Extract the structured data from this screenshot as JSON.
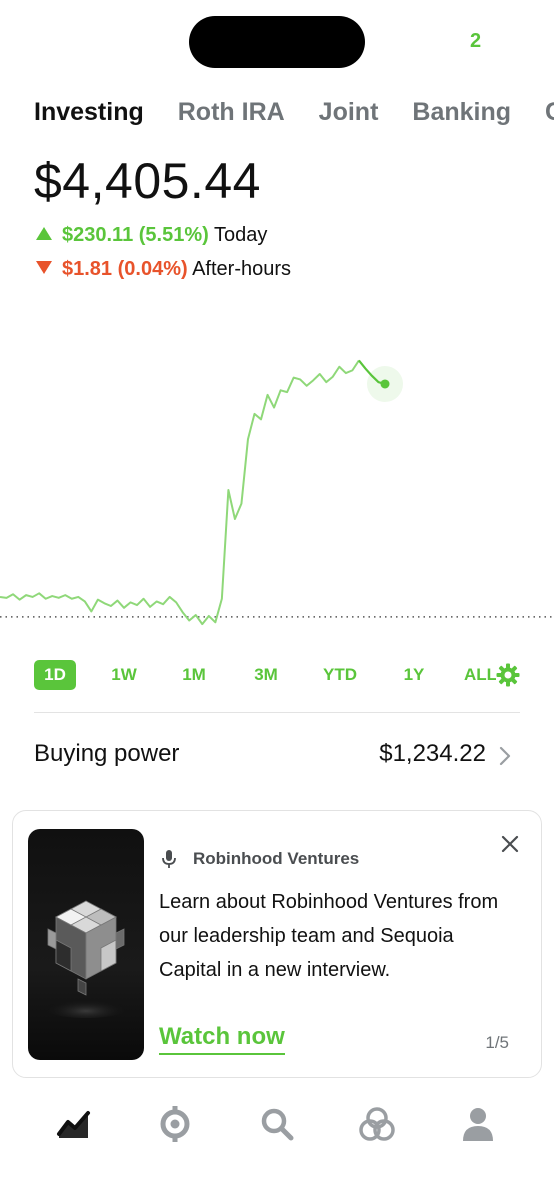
{
  "status_bar": {
    "badge": "2"
  },
  "tabs": [
    {
      "label": "Investing",
      "active": true
    },
    {
      "label": "Roth IRA",
      "active": false
    },
    {
      "label": "Joint",
      "active": false
    },
    {
      "label": "Banking",
      "active": false
    },
    {
      "label": "Cr",
      "active": false
    }
  ],
  "portfolio": {
    "balance": "$4,405.44",
    "today": {
      "value": "$230.11 (5.51%)",
      "label": "Today",
      "direction": "up"
    },
    "after_hours": {
      "value": "$1.81 (0.04%)",
      "label": "After-hours",
      "direction": "down"
    }
  },
  "chart_data": {
    "type": "line",
    "series": [
      {
        "values": [
          2.2,
          2.1,
          2.5,
          1.9,
          2.4,
          2.2,
          2.6,
          2.0,
          2.3,
          2.1,
          2.4,
          2.0,
          2.2,
          1.7,
          0.6,
          1.9,
          1.5,
          1.2,
          1.8,
          1.0,
          1.6,
          1.3,
          2.0,
          1.1,
          1.7,
          1.4,
          2.2,
          1.6,
          0.5,
          -0.4,
          0.2,
          -0.8,
          0.1,
          -0.6,
          2.0,
          14.0,
          10.8,
          12.5,
          19.6,
          22.4,
          21.8,
          24.5,
          23.1,
          25.0,
          24.8,
          26.4,
          26.2,
          25.5,
          26.1,
          26.8,
          25.9,
          26.5,
          27.6,
          26.9,
          27.2,
          28.3,
          27.4,
          26.6,
          25.9,
          25.7
        ]
      }
    ],
    "baseline": 0,
    "up_color": "#5ac53b"
  },
  "ranges": [
    {
      "label": "1D",
      "active": true
    },
    {
      "label": "1W",
      "active": false
    },
    {
      "label": "1M",
      "active": false
    },
    {
      "label": "3M",
      "active": false
    },
    {
      "label": "YTD",
      "active": false
    },
    {
      "label": "1Y",
      "active": false
    },
    {
      "label": "ALL",
      "active": false
    }
  ],
  "buying_power": {
    "label": "Buying power",
    "value": "$1,234.22"
  },
  "promo_card": {
    "source": "Robinhood Ventures",
    "body": "Learn about Robinhood Ventures from our leadership team and Sequoia Capital in a new interview.",
    "cta": "Watch now",
    "pager": "1/5"
  },
  "bottom_nav": [
    {
      "icon": "investing-chart-icon",
      "active": true
    },
    {
      "icon": "crypto-icon",
      "active": false
    },
    {
      "icon": "search-icon",
      "active": false
    },
    {
      "icon": "network-icon",
      "active": false
    },
    {
      "icon": "account-icon",
      "active": false
    }
  ],
  "colors": {
    "accent": "#5ac53b",
    "negative": "#e8532b",
    "text": "#111111",
    "muted": "#6f7478"
  }
}
